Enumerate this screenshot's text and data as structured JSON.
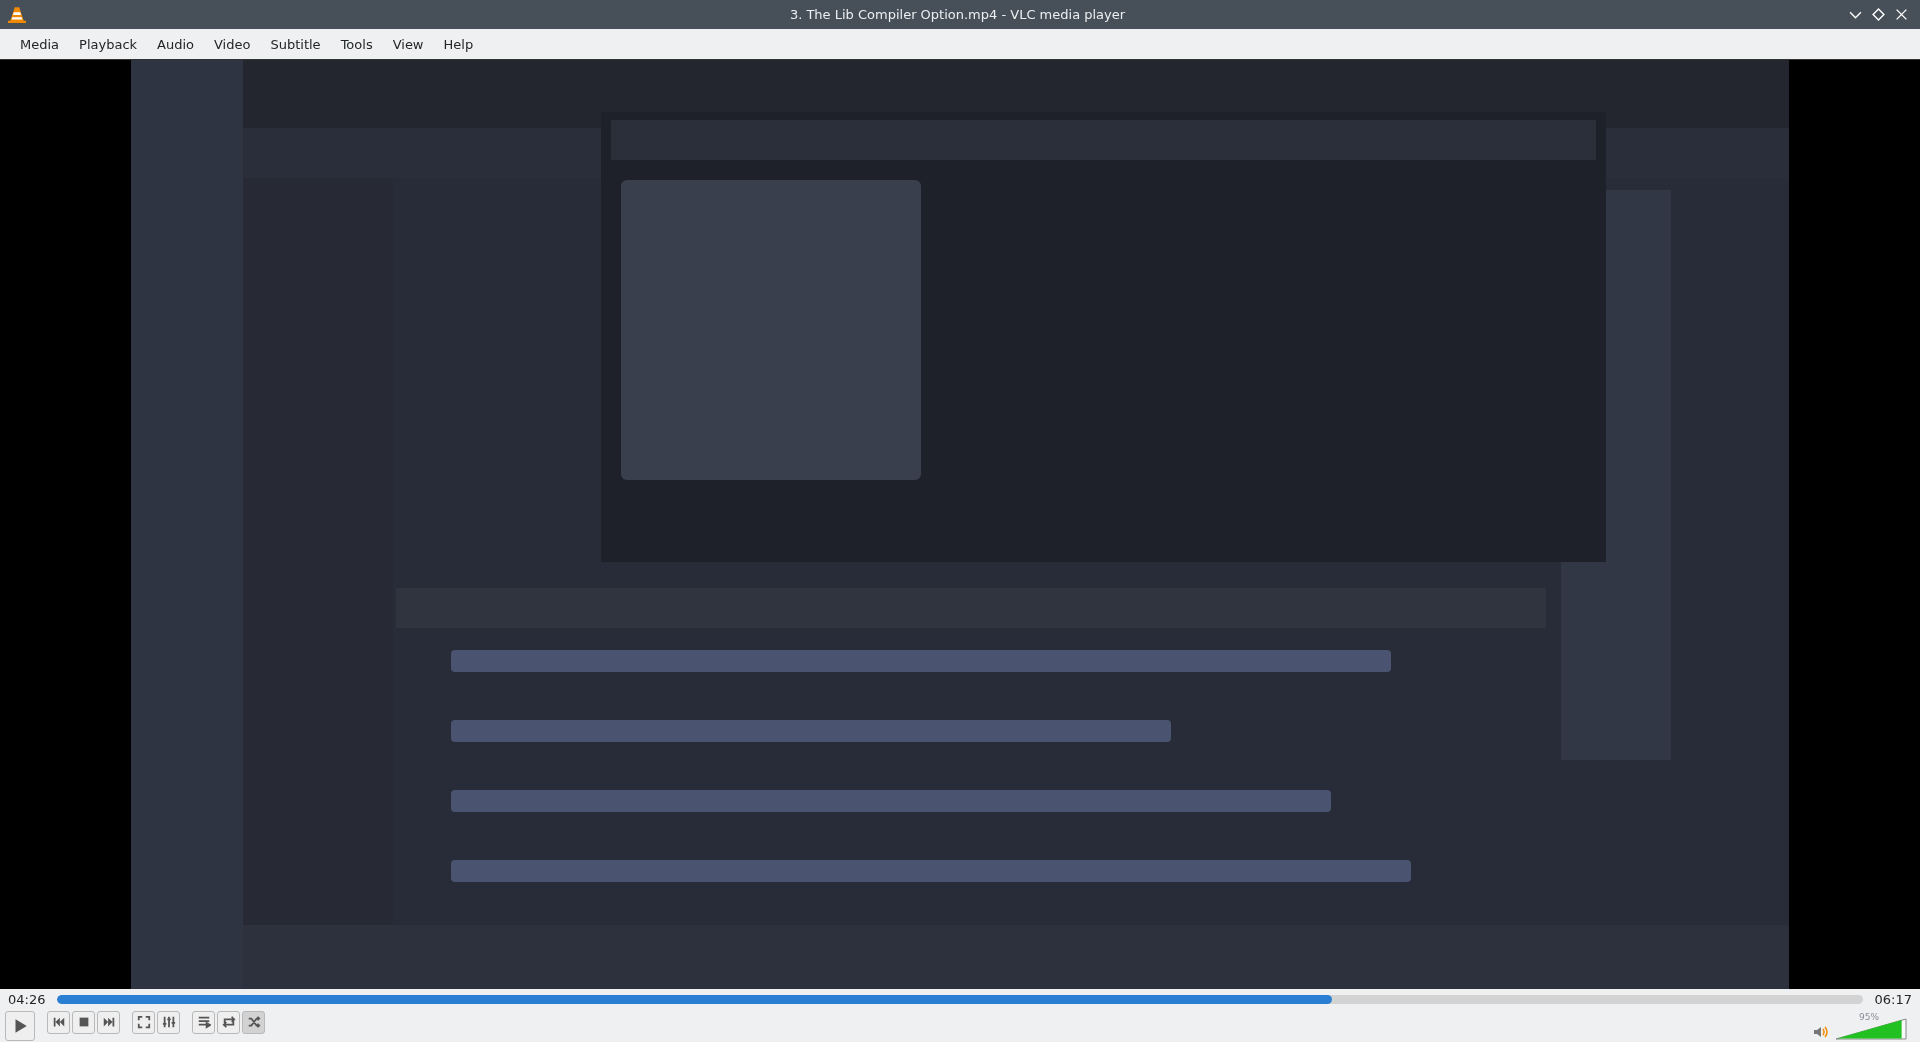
{
  "window": {
    "title": "3. The Lib Compiler Option.mp4 - VLC media player"
  },
  "menu": [
    "Media",
    "Playback",
    "Audio",
    "Video",
    "Subtitle",
    "Tools",
    "View",
    "Help"
  ],
  "video": {
    "kind": "picture"
  },
  "seek": {
    "elapsed": "04:26",
    "level": 0.706,
    "total": "06:17"
  },
  "controls": [
    [
      {
        "kind": "play"
      }
    ],
    [
      {
        "kind": "previous"
      },
      {
        "kind": "stop"
      },
      {
        "kind": "next"
      }
    ],
    [
      {
        "kind": "fullscreen"
      },
      {
        "kind": "extended"
      }
    ],
    [
      {
        "kind": "playlist"
      },
      {
        "kind": "loop",
        "on": false
      },
      {
        "kind": "shuffle",
        "on": true
      }
    ]
  ],
  "volume": {
    "level": 0.95,
    "reading": "95%"
  }
}
